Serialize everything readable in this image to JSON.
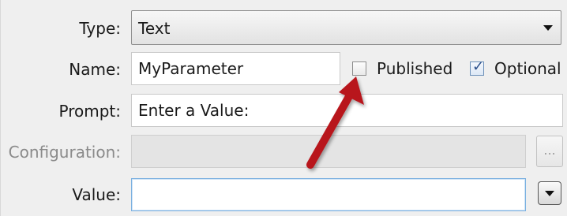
{
  "type_field": {
    "label": "Type:",
    "value": "Text"
  },
  "name_field": {
    "label": "Name:",
    "value": "MyParameter"
  },
  "published_checkbox": {
    "label": "Published",
    "checked": false
  },
  "optional_checkbox": {
    "label": "Optional",
    "checked": true
  },
  "prompt_field": {
    "label": "Prompt:",
    "value": "Enter a Value:"
  },
  "configuration_field": {
    "label": "Configuration:",
    "value": "",
    "browse_label": "...",
    "enabled": false
  },
  "value_field": {
    "label": "Value:",
    "value": ""
  },
  "colors": {
    "annotation_arrow": "#b8141b",
    "focus_border": "#7ab0e0"
  },
  "icons": {
    "dropdown": "chevron-down-icon",
    "annotation": "red-arrow-icon"
  }
}
